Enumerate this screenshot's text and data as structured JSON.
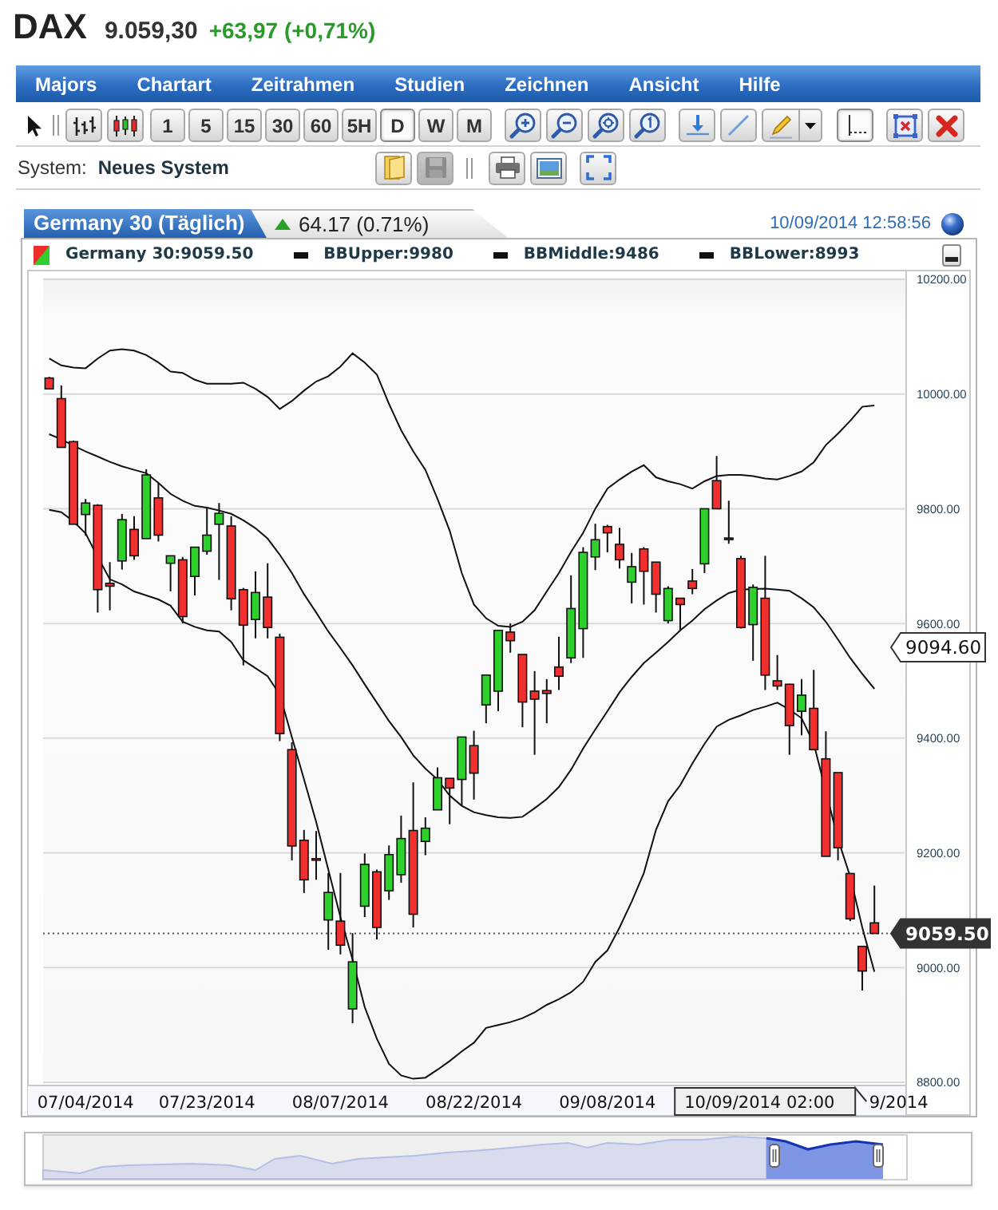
{
  "header": {
    "symbol": "DAX",
    "price": "9.059,30",
    "change": "+63,97 (+0,71%)"
  },
  "menu": [
    "Majors",
    "Chartart",
    "Zeitrahmen",
    "Studien",
    "Zeichnen",
    "Ansicht",
    "Hilfe"
  ],
  "toolbar": {
    "timeframes": [
      {
        "label": "1",
        "selected": false
      },
      {
        "label": "5",
        "selected": false
      },
      {
        "label": "15",
        "selected": false
      },
      {
        "label": "30",
        "selected": false
      },
      {
        "label": "60",
        "selected": false
      },
      {
        "label": "5H",
        "selected": false
      },
      {
        "label": "D",
        "selected": true
      },
      {
        "label": "W",
        "selected": false
      },
      {
        "label": "M",
        "selected": false
      }
    ],
    "crosshair_on": true
  },
  "system_bar": {
    "label": "System:",
    "value": "Neues System",
    "save_disabled": true
  },
  "chart": {
    "tab": "Germany 30 (Täglich)",
    "change": "64.17 (0.71%)",
    "timestamp": "10/09/2014 12:58:56",
    "legend": [
      {
        "kind": "price",
        "text": "Germany 30:9059.50"
      },
      {
        "kind": "line",
        "value": ":9980"
      },
      {
        "kind": "line",
        "value": ":9486"
      },
      {
        "kind": "line",
        "value": ":8993"
      }
    ],
    "price_marker": "9094.60",
    "last_price": "9059.50",
    "date_tooltip": "10/09/2014 02:00",
    "chart_data": {
      "type": "candlestick",
      "grid": true,
      "categories": [
        null,
        null,
        null,
        "07/04/2014",
        null,
        null,
        null,
        null,
        null,
        null,
        null,
        null,
        null,
        "07/23/2014",
        null,
        null,
        null,
        null,
        null,
        null,
        null,
        null,
        null,
        null,
        "08/07/2014",
        null,
        null,
        null,
        null,
        null,
        null,
        null,
        null,
        null,
        null,
        "08/22/2014",
        null,
        null,
        null,
        null,
        null,
        null,
        null,
        null,
        null,
        null,
        "09/08/2014",
        null,
        null,
        null,
        null,
        null,
        null,
        null,
        null,
        null,
        null,
        null,
        null,
        null,
        null,
        null,
        null,
        null,
        null,
        null,
        null,
        null,
        null,
        null,
        "9/2014"
      ],
      "ylim": [
        8800,
        10200
      ],
      "yticks": [
        {
          "value": 8800,
          "label": "8800.00"
        },
        {
          "value": 9000,
          "label": "9000.00"
        },
        {
          "value": 9200,
          "label": "9200.00"
        },
        {
          "value": 9400,
          "label": "9400.00"
        },
        {
          "value": 9600,
          "label": "9600.00"
        },
        {
          "value": 9800,
          "label": "9800.00"
        },
        {
          "value": 10000,
          "label": "10000.00"
        },
        {
          "value": 10200,
          "label": "10200.00"
        }
      ],
      "ohlc": [
        [
          10028,
          10030,
          10008,
          10009
        ],
        [
          9992,
          10015,
          9907,
          9907
        ],
        [
          9917,
          9919,
          9773,
          9773
        ],
        [
          9790,
          9817,
          9753,
          9810
        ],
        [
          9806,
          9808,
          9619,
          9659
        ],
        [
          9670,
          9707,
          9623,
          9665
        ],
        [
          9709,
          9791,
          9694,
          9781
        ],
        [
          9764,
          9787,
          9711,
          9718
        ],
        [
          9748,
          9869,
          9748,
          9859
        ],
        [
          9819,
          9845,
          9743,
          9754
        ],
        [
          9705,
          9718,
          9656,
          9718
        ],
        [
          9711,
          9716,
          9600,
          9612
        ],
        [
          9682,
          9733,
          9649,
          9733
        ],
        [
          9726,
          9801,
          9720,
          9754
        ],
        [
          9773,
          9810,
          9676,
          9792
        ],
        [
          9770,
          9787,
          9623,
          9643
        ],
        [
          9659,
          9662,
          9527,
          9597
        ],
        [
          9607,
          9691,
          9574,
          9654
        ],
        [
          9646,
          9705,
          9574,
          9593
        ],
        [
          9576,
          9582,
          9395,
          9408
        ],
        [
          9380,
          9393,
          9187,
          9212
        ],
        [
          9222,
          9240,
          9130,
          9153
        ],
        [
          9190,
          9238,
          9153,
          9189
        ],
        [
          9083,
          9165,
          9031,
          9131
        ],
        [
          9081,
          9165,
          9023,
          9039
        ],
        [
          8928,
          9060,
          8903,
          9010
        ],
        [
          9107,
          9199,
          9088,
          9180
        ],
        [
          9167,
          9171,
          9049,
          9070
        ],
        [
          9134,
          9213,
          9118,
          9197
        ],
        [
          9162,
          9265,
          9148,
          9225
        ],
        [
          9239,
          9323,
          9070,
          9093
        ],
        [
          9220,
          9262,
          9196,
          9243
        ],
        [
          9275,
          9349,
          9275,
          9331
        ],
        [
          9330,
          9330,
          9250,
          9313
        ],
        [
          9328,
          9402,
          9282,
          9402
        ],
        [
          9387,
          9413,
          9293,
          9339
        ],
        [
          9458,
          9510,
          9426,
          9510
        ],
        [
          9482,
          9588,
          9447,
          9588
        ],
        [
          9585,
          9600,
          9549,
          9570
        ],
        [
          9546,
          9546,
          9419,
          9463
        ],
        [
          9482,
          9517,
          9371,
          9468
        ],
        [
          9483,
          9503,
          9426,
          9478
        ],
        [
          9524,
          9577,
          9484,
          9508
        ],
        [
          9540,
          9684,
          9531,
          9626
        ],
        [
          9591,
          9733,
          9540,
          9724
        ],
        [
          9716,
          9774,
          9693,
          9746
        ],
        [
          9769,
          9772,
          9724,
          9758
        ],
        [
          9738,
          9767,
          9696,
          9711
        ],
        [
          9672,
          9723,
          9635,
          9699
        ],
        [
          9730,
          9733,
          9633,
          9691
        ],
        [
          9707,
          9707,
          9619,
          9651
        ],
        [
          9605,
          9665,
          9600,
          9661
        ],
        [
          9644,
          9644,
          9589,
          9633
        ],
        [
          9674,
          9695,
          9651,
          9661
        ],
        [
          9704,
          9800,
          9688,
          9800
        ],
        [
          9849,
          9892,
          9800,
          9800
        ],
        [
          9749,
          9814,
          9739,
          9748
        ],
        [
          9713,
          9718,
          9591,
          9593
        ],
        [
          9598,
          9668,
          9535,
          9663
        ],
        [
          9644,
          9718,
          9484,
          9510
        ],
        [
          9500,
          9545,
          9484,
          9491
        ],
        [
          9494,
          9495,
          9371,
          9422
        ],
        [
          9447,
          9503,
          9405,
          9475
        ],
        [
          9452,
          9519,
          9380,
          9380
        ],
        [
          9364,
          9412,
          9194,
          9194
        ],
        [
          9340,
          9340,
          9187,
          9209
        ],
        [
          9164,
          9164,
          9081,
          9085
        ],
        [
          9037,
          9037,
          8960,
          8994
        ],
        [
          9078,
          9143,
          9059.5,
          9059.5
        ],
        null,
        null
      ],
      "series": [
        {
          "name": "BBUpper",
          "type": "line",
          "values": [
            10062,
            10050,
            10046,
            10045,
            10062,
            10076,
            10078,
            10076,
            10068,
            10055,
            10039,
            10037,
            10025,
            10018,
            10018,
            10018,
            10020,
            10009,
            9995,
            9974,
            9988,
            10006,
            10022,
            10031,
            10048,
            10071,
            10055,
            10034,
            9983,
            9937,
            9900,
            9868,
            9817,
            9762,
            9688,
            9633,
            9609,
            9596,
            9594,
            9603,
            9623,
            9656,
            9688,
            9725,
            9758,
            9800,
            9835,
            9851,
            9865,
            9876,
            9855,
            9848,
            9843,
            9835,
            9848,
            9857,
            9859,
            9859,
            9857,
            9853,
            9851,
            9857,
            9865,
            9881,
            9911,
            9931,
            9953,
            9978,
            9980,
            null,
            null
          ]
        },
        {
          "name": "BBMiddle",
          "type": "line",
          "values": [
            9930,
            9921,
            9910,
            9900,
            9891,
            9882,
            9874,
            9868,
            9862,
            9845,
            9826,
            9814,
            9805,
            9802,
            9797,
            9791,
            9780,
            9766,
            9748,
            9720,
            9688,
            9651,
            9619,
            9586,
            9557,
            9527,
            9494,
            9462,
            9430,
            9402,
            9370,
            9347,
            9328,
            9300,
            9282,
            9271,
            9266,
            9262,
            9261,
            9263,
            9278,
            9294,
            9315,
            9345,
            9382,
            9415,
            9447,
            9480,
            9507,
            9531,
            9549,
            9568,
            9588,
            9605,
            9625,
            9640,
            9653,
            9659,
            9660,
            9661,
            9659,
            9657,
            9644,
            9628,
            9603,
            9572,
            9540,
            9512,
            9486,
            null,
            null
          ]
        },
        {
          "name": "BBLower",
          "type": "line",
          "values": [
            9798,
            9794,
            9778,
            9757,
            9716,
            9677,
            9668,
            9656,
            9649,
            9642,
            9631,
            9603,
            9594,
            9588,
            9586,
            9568,
            9536,
            9522,
            9508,
            9476,
            9402,
            9328,
            9254,
            9171,
            9088,
            9014,
            8931,
            8876,
            8832,
            8812,
            8806,
            8808,
            8822,
            8837,
            8854,
            8869,
            8895,
            8900,
            8905,
            8912,
            8922,
            8935,
            8945,
            8957,
            8975,
            9010,
            9030,
            9070,
            9115,
            9165,
            9240,
            9290,
            9318,
            9356,
            9390,
            9420,
            9432,
            9440,
            9449,
            9455,
            9462,
            9450,
            9435,
            9391,
            9307,
            9224,
            9159,
            9070,
            8993,
            null,
            null
          ]
        }
      ],
      "ref_lines": [
        {
          "axis": "y",
          "value": 9059.5
        }
      ]
    }
  }
}
